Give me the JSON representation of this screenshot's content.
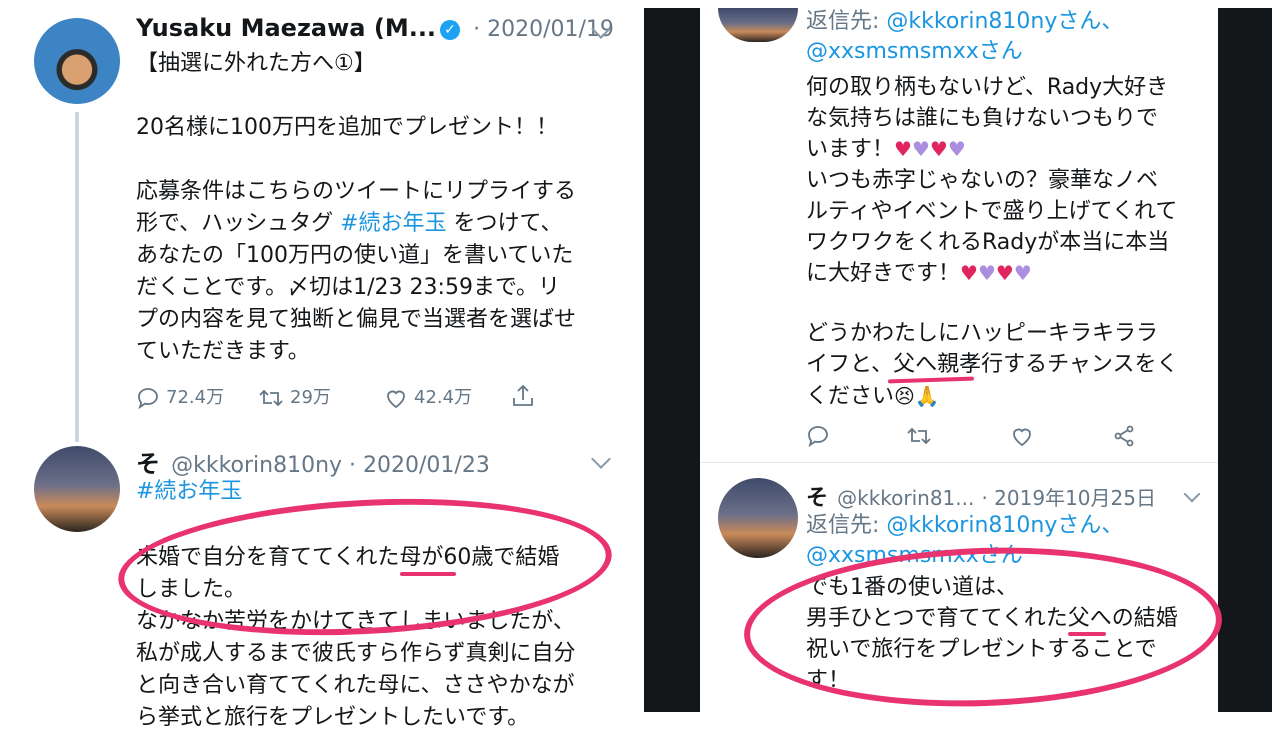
{
  "left": {
    "tweet": {
      "author_name": "Yusaku Maezawa (M...",
      "date": "· 2020/01/19",
      "lines": [
        "【抽選に外れた方へ①】",
        "",
        "20名様に100万円を追加でプレゼント！！",
        "",
        "応募条件はこちらのツイートにリプライする",
        "あなたの「100万円の使い道」を書いていた",
        "だくことです。〆切は1/23 23:59まで。リ",
        "プの内容を見て独断と偏見で当選者を選ばせ",
        "ていただきます。"
      ],
      "line5_pre": "形で、ハッシュタグ ",
      "line5_tag": "#続お年玉",
      "line5_post": " をつけて、",
      "actions": {
        "replies": "72.4万",
        "retweets": "29万",
        "likes": "42.4万"
      }
    },
    "reply": {
      "author_name": "そ",
      "handle": "@kkkorin810ny · 2020/01/23",
      "hashtag": "#続お年玉",
      "lines": [
        "未婚で自分を育ててくれた母が60歳で結婚",
        "しました。",
        "なかなか苦労をかけてきてしまいましたが、",
        "私が成人するまで彼氏すら作らず真剣に自分",
        "と向き合い育ててくれた母に、ささやかなが",
        "ら挙式と旅行をプレゼントしたいです。"
      ]
    }
  },
  "right": {
    "tweet1": {
      "reply_to_label": "返信先: ",
      "reply_to_1": "@kkkorin810nyさん、",
      "reply_to_2": "@xxsmsmsmxxさん",
      "lines_a": [
        "何の取り柄もないけど、Rady大好き",
        "な気持ちは誰にも負けないつもりで"
      ],
      "line_c": "います！",
      "lines_b": [
        "いつも赤字じゃないの？豪華なノベ",
        "ルティやイベントで盛り上げてくれて",
        "ワクワクをくれるRadyが本当に本当"
      ],
      "line_d": "に大好きです！",
      "lines_e": [
        "どうかわたしにハッピーキラキララ",
        "イフと、父へ親孝行するチャンスをく"
      ],
      "line_f": "ください"
    },
    "tweet2": {
      "author_name": "そ",
      "handle": "@kkkorin81...",
      "date": "· 2019年10月25日",
      "reply_to_label": "返信先: ",
      "reply_to_1": "@kkkorin810nyさん、",
      "reply_to_2": "@xxsmsmsmxxさん",
      "lines": [
        "でも1番の使い道は、",
        "男手ひとつで育ててくれた父への結婚",
        "祝いで旅行をプレゼントすることで",
        "す！"
      ]
    }
  },
  "colors": {
    "accent": "#1b95e0",
    "annotation": "#e8336e",
    "gray": "#657786"
  }
}
